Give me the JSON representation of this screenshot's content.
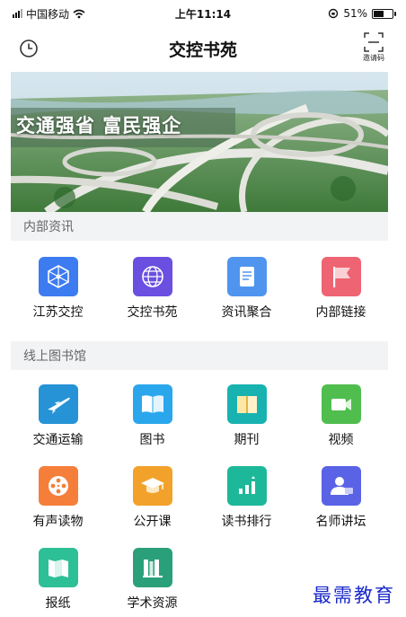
{
  "status_bar": {
    "carrier": "中国移动",
    "time": "上午11:14",
    "battery": "51%",
    "battery_level": 0.51
  },
  "nav": {
    "title": "交控书苑",
    "history_icon": "clock-icon",
    "invite_label": "邀请码",
    "invite_icon": "scan-frame-icon"
  },
  "banner": {
    "slogan": "交通强省 富民强企"
  },
  "sections": [
    {
      "title": "内部资讯",
      "items": [
        {
          "label": "江苏交控",
          "icon": "network-node-icon",
          "color": "#3d7bf0"
        },
        {
          "label": "交控书苑",
          "icon": "globe-icon",
          "color": "#6a4fe0"
        },
        {
          "label": "资讯聚合",
          "icon": "document-list-icon",
          "color": "#4f95ef"
        },
        {
          "label": "内部链接",
          "icon": "flag-icon",
          "color": "#ee6472"
        }
      ]
    },
    {
      "title": "线上图书馆",
      "items": [
        {
          "label": "交通运输",
          "icon": "airplane-icon",
          "color": "#2593d6"
        },
        {
          "label": "图书",
          "icon": "open-book-icon",
          "color": "#2aa7ec"
        },
        {
          "label": "期刊",
          "icon": "magazine-icon",
          "color": "#18b3b1"
        },
        {
          "label": "视频",
          "icon": "video-camera-icon",
          "color": "#50be4e"
        },
        {
          "label": "有声读物",
          "icon": "film-reel-icon",
          "color": "#f57f3a"
        },
        {
          "label": "公开课",
          "icon": "graduation-cap-icon",
          "color": "#f2a22a"
        },
        {
          "label": "读书排行",
          "icon": "bar-ranking-icon",
          "color": "#1db89a"
        },
        {
          "label": "名师讲坛",
          "icon": "teacher-icon",
          "color": "#5a63e6"
        },
        {
          "label": "报纸",
          "icon": "newspaper-icon",
          "color": "#2dbf96"
        },
        {
          "label": "学术资源",
          "icon": "bookshelf-icon",
          "color": "#2aa07a"
        }
      ]
    }
  ],
  "watermark": "最需教育"
}
